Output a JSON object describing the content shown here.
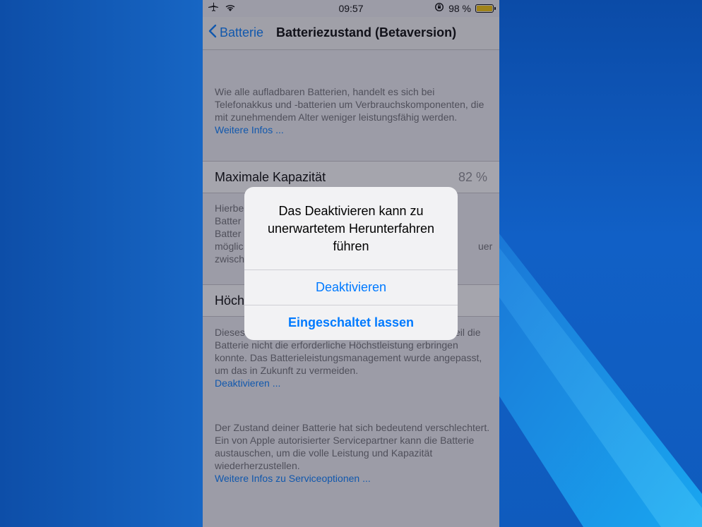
{
  "status_bar": {
    "time": "09:57",
    "battery_percent": "98 %",
    "battery_level": 0.98,
    "icons": [
      "airplane-icon",
      "wifi-icon",
      "rotation-lock-icon",
      "battery-icon"
    ]
  },
  "nav": {
    "back_label": "Batterie",
    "title": "Batteriezustand (Betaversion)"
  },
  "intro": {
    "text": "Wie alle aufladbaren Batterien, handelt es sich bei Telefonakkus und -batterien um Verbrauchskomponenten, die mit zunehmendem Alter weniger leistungsfähig werden.",
    "link": "Weitere Infos ..."
  },
  "capacity": {
    "label": "Maximale Kapazität",
    "value": "82 %"
  },
  "capacity_note": {
    "lines": [
      "Hierbe",
      "Batter",
      "Batter",
      "möglic",
      "zwisch"
    ],
    "right_fragment": "uer"
  },
  "peak": {
    "label_partial": "Höch"
  },
  "peak_note": {
    "lead": "Dieses",
    "tail": "eil die",
    "text": "Batterie nicht die erforderliche Höchstleistung erbringen konnte. Das Batterieleistungsmanagement wurde angepasst, um das in Zukunft zu vermeiden.",
    "link": "Deaktivieren ..."
  },
  "service_note": {
    "text": "Der Zustand deiner Batterie hat sich bedeutend verschlechtert. Ein von Apple autorisierter Servicepartner kann die Batterie austauschen, um die volle Leistung und Kapazität wiederherzustellen.",
    "link": "Weitere Infos zu Serviceoptionen ..."
  },
  "alert": {
    "message": "Das Deaktivieren kann zu unerwartetem Herunterfahren führen",
    "buttons": [
      "Deaktivieren",
      "Eingeschaltet lassen"
    ]
  },
  "colors": {
    "accent": "#007aff",
    "battery": "#f7c500",
    "wallpaper": "#1458b8"
  }
}
